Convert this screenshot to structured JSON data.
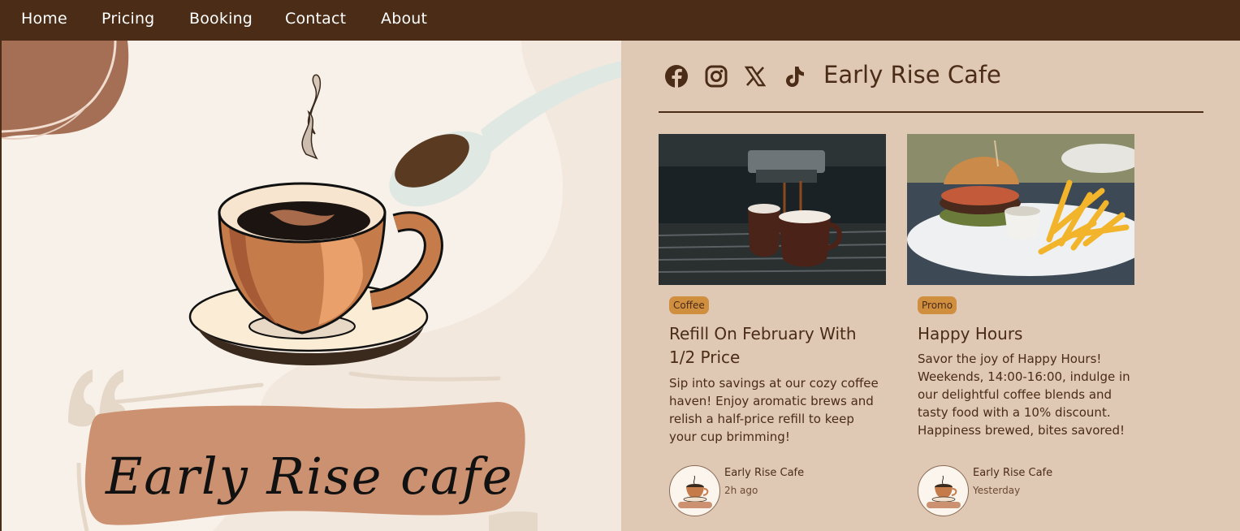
{
  "nav": {
    "items": [
      {
        "label": "Home"
      },
      {
        "label": "Pricing"
      },
      {
        "label": "Booking"
      },
      {
        "label": "Contact"
      },
      {
        "label": "About"
      }
    ]
  },
  "hero": {
    "title": "Early Rise cafe"
  },
  "brand": {
    "title": "Early Rise Cafe",
    "social": [
      "facebook-icon",
      "instagram-icon",
      "x-icon",
      "tiktok-icon"
    ]
  },
  "cards": [
    {
      "tag": "Coffee",
      "title": "Refill On February With 1/2 Price",
      "description": "Sip into savings at our cozy coffee haven! Enjoy aromatic brews and relish a half-price refill to keep your cup brimming!",
      "author": "Early Rise Cafe",
      "time": "2h ago"
    },
    {
      "tag": "Promo",
      "title": "Happy Hours",
      "description": "Savor the joy of Happy Hours! Weekends, 14:00-16:00, indulge in our delightful coffee blends and tasty food with a 10% discount. Happiness brewed, bites savored!",
      "author": "Early Rise Cafe",
      "time": "Yesterday"
    }
  ],
  "colors": {
    "nav_bg": "#4a2c17",
    "hero_bg": "#f8f1ea",
    "panel_bg": "#dfc8b4",
    "tag_bg": "#d08f3f",
    "text_brown": "#4a2c17"
  }
}
